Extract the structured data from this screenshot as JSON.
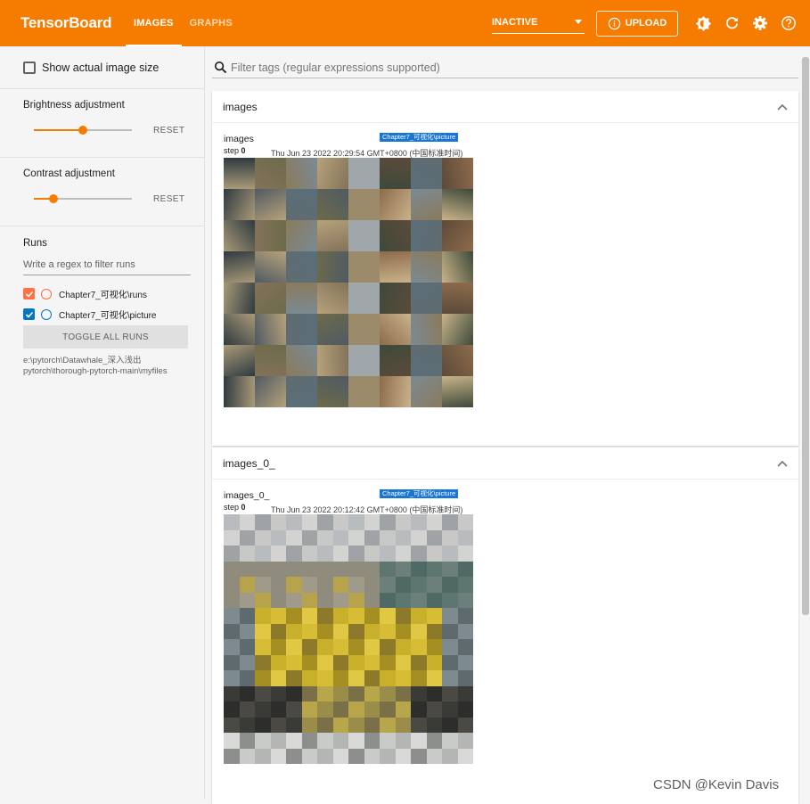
{
  "header": {
    "brand": "TensorBoard",
    "tabs": [
      {
        "label": "IMAGES",
        "active": true
      },
      {
        "label": "GRAPHS",
        "active": false
      }
    ],
    "status": "INACTIVE",
    "upload_label": "UPLOAD",
    "accent": "#f57c00"
  },
  "sidebar": {
    "show_actual_size": "Show actual image size",
    "brightness": {
      "label": "Brightness adjustment",
      "reset": "RESET",
      "value_pct": 50
    },
    "contrast": {
      "label": "Contrast adjustment",
      "reset": "RESET",
      "value_pct": 20
    },
    "runs": {
      "title": "Runs",
      "filter_placeholder": "Write a regex to filter runs",
      "items": [
        {
          "name": "Chapter7_可视化\\runs",
          "color": "#ff7043",
          "checked": true
        },
        {
          "name": "Chapter7_可视化\\picture",
          "color": "#0277bd",
          "checked": true
        }
      ],
      "toggle_label": "TOGGLE ALL RUNS",
      "logdir_line1": "e:\\pytorch\\Datawhale_深入浅出",
      "logdir_line2": "pytorch\\thorough-pytorch-main\\myfiles"
    }
  },
  "main": {
    "filter_placeholder": "Filter tags (regular expressions supported)",
    "cards": [
      {
        "title": "images",
        "tag": "images",
        "run": "Chapter7_可视化\\picture",
        "step_label": "step",
        "step": "0",
        "wall_time": "Thu Jun 23 2022 20:29:54 GMT+0800 (中国标准时间)"
      },
      {
        "title": "images_0_",
        "tag": "images_0_",
        "run": "Chapter7_可视化\\picture",
        "step_label": "step",
        "step": "0",
        "wall_time": "Thu Jun 23 2022 20:12:42 GMT+0800 (中国标准时间)"
      }
    ]
  },
  "watermark": "CSDN @Kevin  Davis"
}
